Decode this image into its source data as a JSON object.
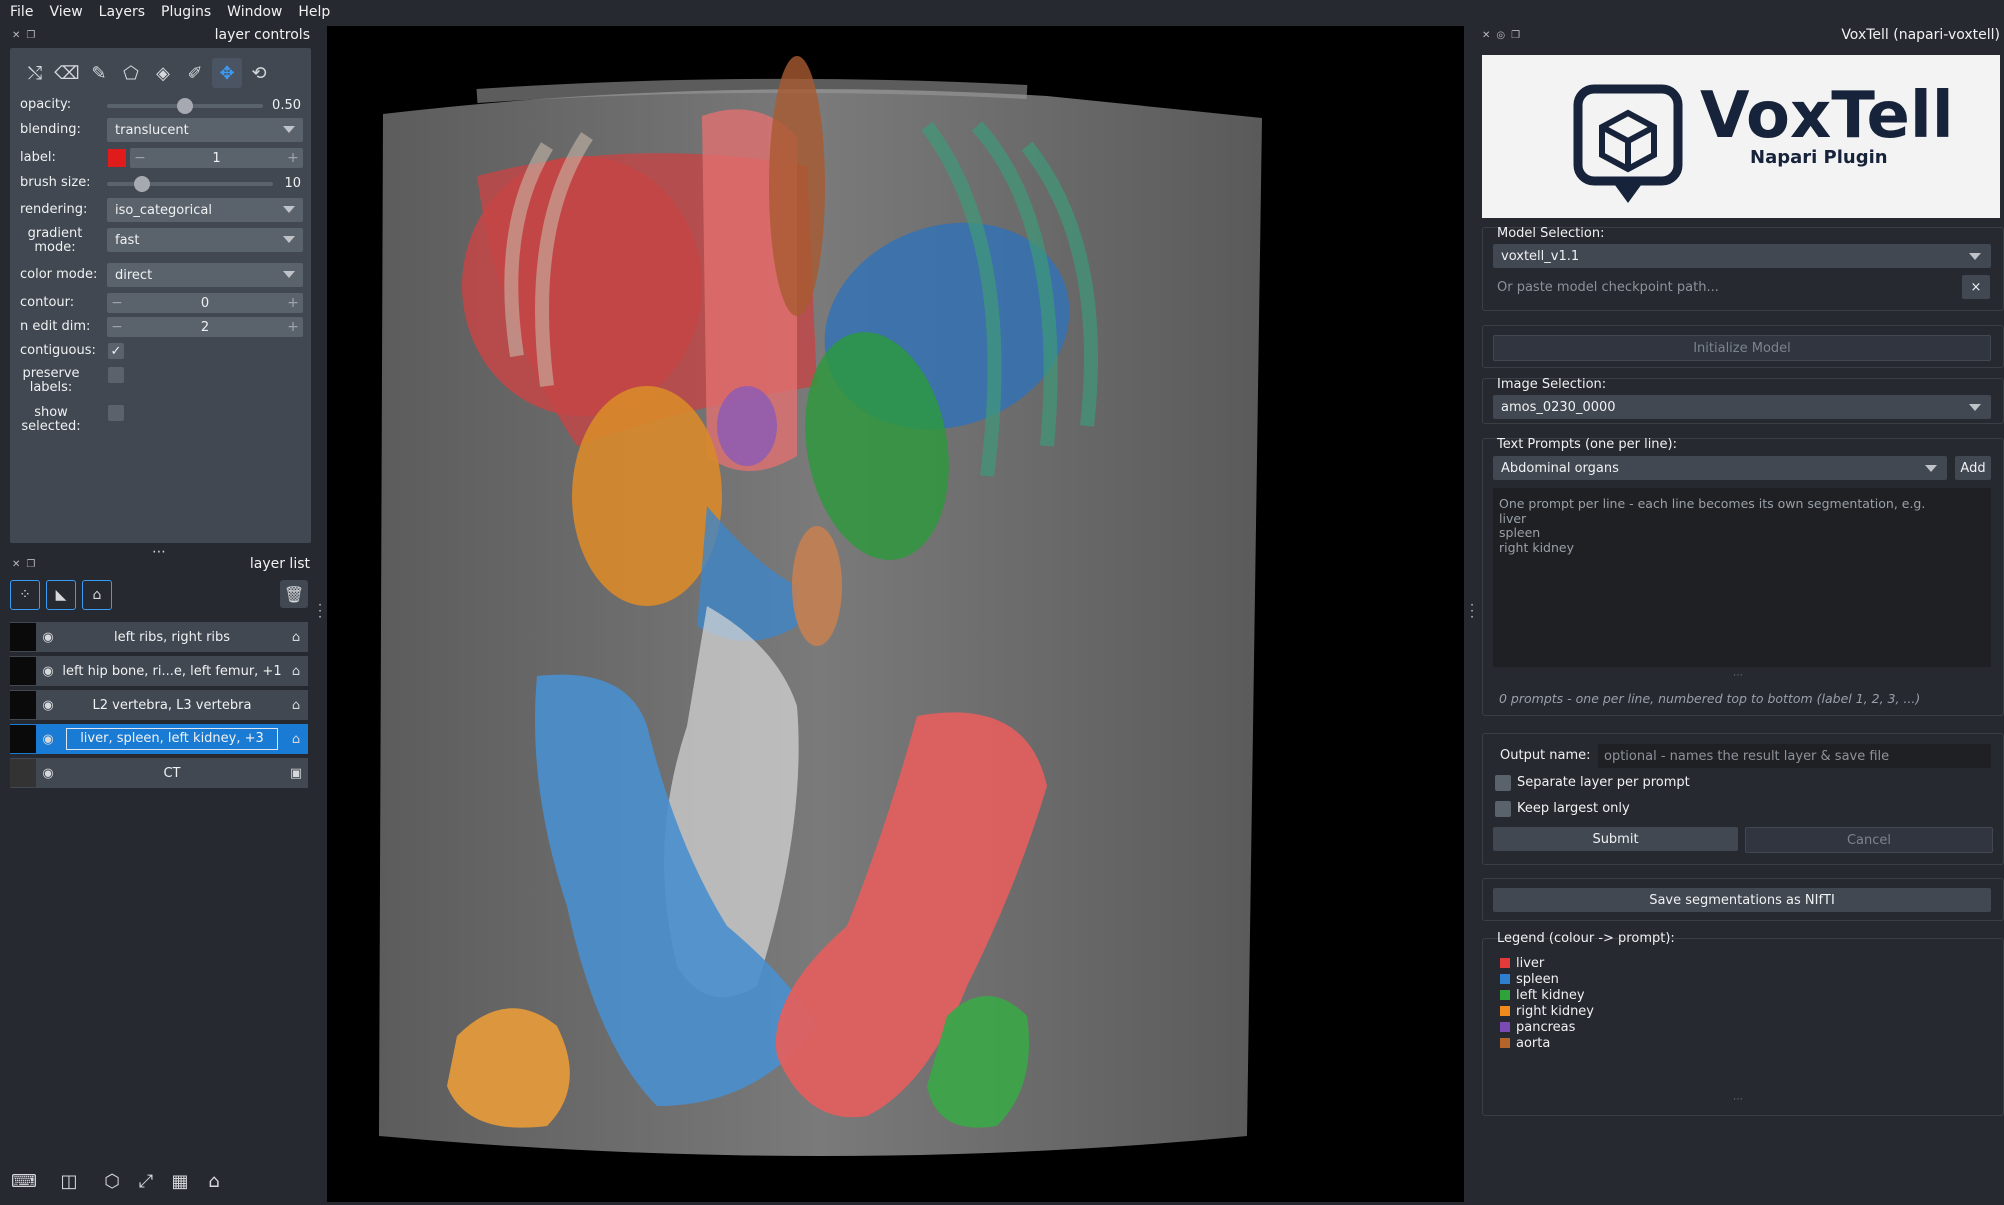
{
  "menu": [
    "File",
    "View",
    "Layers",
    "Plugins",
    "Window",
    "Help"
  ],
  "layer_controls": {
    "title": "layer controls",
    "opacity_label": "opacity:",
    "opacity_value": "0.50",
    "opacity_level": 0.5,
    "blending_label": "blending:",
    "blending_value": "translucent",
    "label_label": "label:",
    "label_value": "1",
    "label_color": "#e01b1b",
    "brush_label": "brush size:",
    "brush_value": "10",
    "brush_level": 0.07,
    "rendering_label": "rendering:",
    "rendering_value": "iso_categorical",
    "gradient_label_1": "gradient",
    "gradient_label_2": "mode:",
    "gradient_value": "fast",
    "color_mode_label": "color mode:",
    "color_mode_value": "direct",
    "contour_label": "contour:",
    "contour_value": "0",
    "nedit_label": "n edit dim:",
    "nedit_value": "2",
    "contiguous_label": "contiguous:",
    "contiguous_checked": true,
    "preserve_label_1": "preserve",
    "preserve_label_2": "labels:",
    "show_label_1": "show",
    "show_label_2": "selected:"
  },
  "layer_list": {
    "title": "layer list",
    "layers": [
      {
        "name": "left ribs, right ribs",
        "type": "labels"
      },
      {
        "name": "left hip bone, ri...e, left femur, +1",
        "type": "labels"
      },
      {
        "name": "L2 vertebra, L3 vertebra",
        "type": "labels"
      },
      {
        "name": "liver, spleen, left kidney, +3",
        "type": "labels",
        "selected": true
      },
      {
        "name": "CT",
        "type": "image"
      }
    ]
  },
  "plugin": {
    "title": "VoxTell (napari-voxtell)",
    "logo_title": "VoxTell",
    "logo_subtitle": "Napari Plugin",
    "model_selection_label": "Model Selection:",
    "model_value": "voxtell_v1.1",
    "checkpoint_placeholder": "Or paste model checkpoint path...",
    "clear_label": "×",
    "init_label": "Initialize Model",
    "image_selection_label": "Image Selection:",
    "image_value": "amos_0230_0000",
    "text_prompts_label": "Text Prompts (one per line):",
    "preset_value": "Abdominal organs",
    "add_label": "Add",
    "prompt_hint_1": "One prompt per line - each line becomes its own segmentation, e.g.",
    "prompt_hint_2": "liver",
    "prompt_hint_3": "spleen",
    "prompt_hint_4": "right kidney",
    "prompt_count": "0 prompts - one per line, numbered top to bottom (label 1, 2, 3, ...)",
    "output_label": "Output name:",
    "output_placeholder": "optional - names the result layer & save file",
    "separate_label": "Separate layer per prompt",
    "largest_label": "Keep largest only",
    "submit_label": "Submit",
    "cancel_label": "Cancel",
    "save_label": "Save segmentations as NIfTI",
    "legend_title": "Legend (colour -> prompt):",
    "legend": [
      {
        "name": "liver",
        "color": "#e53a3a"
      },
      {
        "name": "spleen",
        "color": "#2f7fd0"
      },
      {
        "name": "left kidney",
        "color": "#2fa23a"
      },
      {
        "name": "right kidney",
        "color": "#f08a1c"
      },
      {
        "name": "pancreas",
        "color": "#7b4bb3"
      },
      {
        "name": "aorta",
        "color": "#b5652a"
      }
    ]
  }
}
